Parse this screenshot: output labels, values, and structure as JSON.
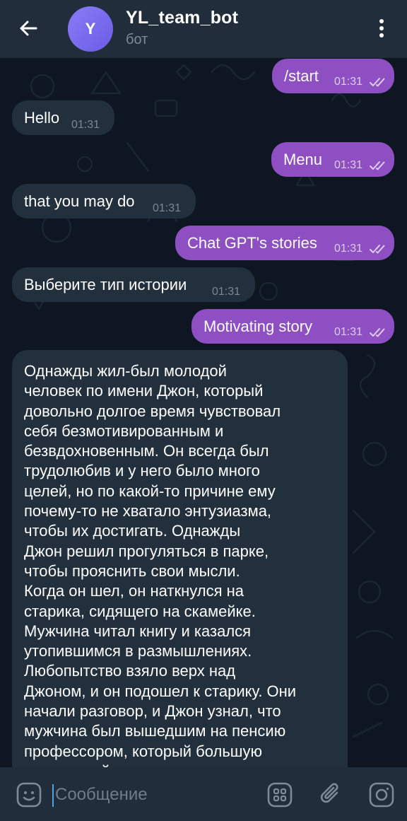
{
  "header": {
    "title": "YL_team_bot",
    "subtitle": "бот",
    "avatar_letter": "Y",
    "avatar_color": "#7a6cf0",
    "back_icon": "arrow-left-icon",
    "menu_icon": "more-vertical-icon"
  },
  "messages": [
    {
      "direction": "out",
      "text": "/start",
      "time": "01:31",
      "status": "read"
    },
    {
      "direction": "in",
      "text": "Hello",
      "time": "01:31"
    },
    {
      "direction": "out",
      "text": "Menu",
      "time": "01:31",
      "status": "read"
    },
    {
      "direction": "in",
      "text": "that you may do",
      "time": "01:31"
    },
    {
      "direction": "out",
      "text": "Chat GPT's stories",
      "time": "01:31",
      "status": "read"
    },
    {
      "direction": "in",
      "text": "Выберите тип истории",
      "time": "01:31"
    },
    {
      "direction": "out",
      "text": "Motivating story",
      "time": "01:31",
      "status": "read"
    },
    {
      "direction": "in",
      "text": "Однажды жил-был молодой\nчеловек по имени Джон, который\nдовольно долгое время чувствовал\nсебя безмотивированным и\nбезвдохновенным. Он всегда был\nтрудолюбив и у него было много\nцелей, но по какой-то причине ему\nпочему-то не хватало энтузиазма,\nчтобы их достигать. Однажды\nДжон решил прогуляться в парке,\nчтобы прояснить свои мысли.\nКогда он шел, он наткнулся на\nстарика, сидящего на скамейке.\nМужчина читал книгу и казался\nутопившимся в размышлениях.\nЛюбопытство взяло верх над\nДжоном, и он подошел к старику. Они\nначали разговор, и Джон узнал, что\nмужчина был вышедшим на пенсию\nпрофессором, который большую\nчасть своей жизни преподавал"
    }
  ],
  "composer": {
    "placeholder": "Сообщение",
    "value": "",
    "icons": [
      "emoji-icon",
      "bot-commands-icon",
      "paperclip-icon",
      "camera-icon"
    ]
  },
  "colors": {
    "background": "#0e1621",
    "header": "#212d3b",
    "outgoing_bubble": "#8e4fc2",
    "incoming_bubble": "#222f3d",
    "caret": "#4fa3e0"
  }
}
